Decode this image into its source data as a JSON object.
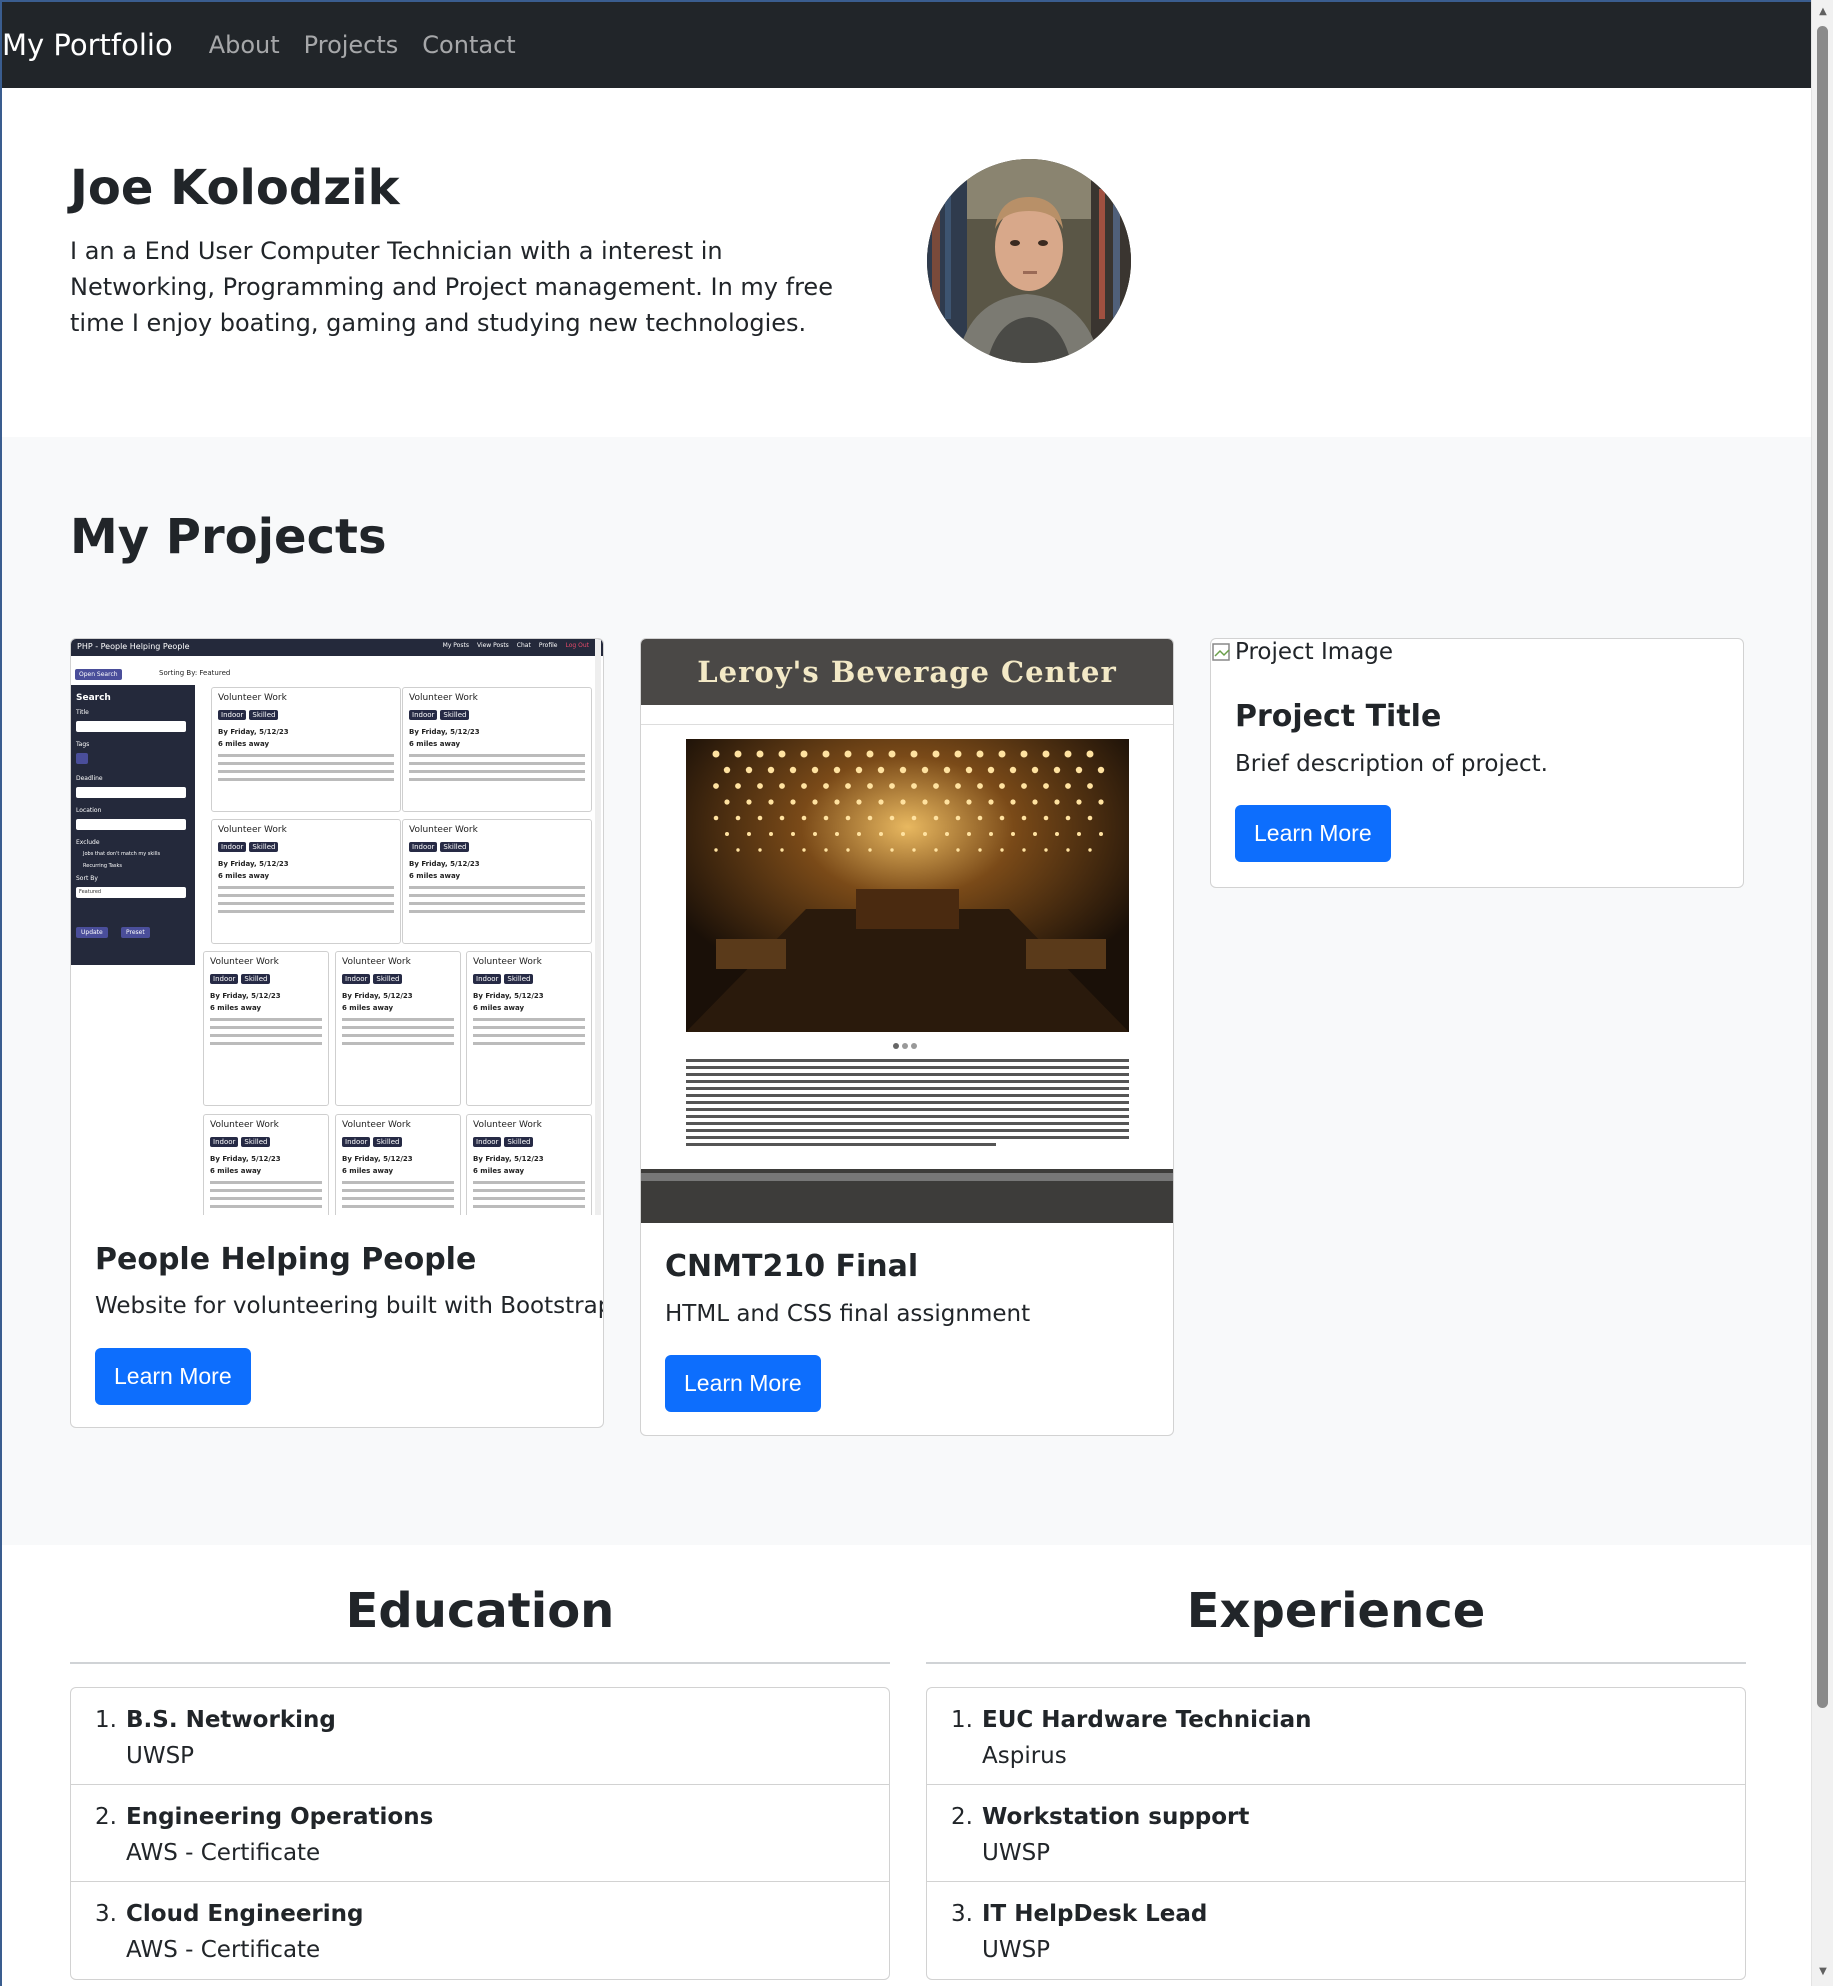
{
  "navbar": {
    "brand": "My Portfolio",
    "links": [
      "About",
      "Projects",
      "Contact"
    ]
  },
  "hero": {
    "name": "Joe Kolodzik",
    "bio": "I an a End User Computer Technician with a interest in Networking, Programming and Project management. In my free time I enjoy boating, gaming and studying new technologies."
  },
  "projects": {
    "title": "My Projects",
    "cards": [
      {
        "title": "People Helping People",
        "description": "Website for volunteering built with Bootstrap.",
        "button": "Learn More",
        "thumbnail": {
          "site_title": "PHP - People Helping People",
          "nav": [
            "My Posts",
            "View Posts",
            "Chat",
            "Profile",
            "Log Out"
          ],
          "open_search": "Open Search",
          "sorting": "Sorting By: Featured",
          "sidebar": {
            "heading": "Search",
            "fields": [
              "Title",
              "Tags",
              "Deadline",
              "Location"
            ],
            "exclude": "Exclude",
            "options": [
              "Jobs that don't match my skills",
              "Recurring Tasks"
            ],
            "sort_by": "Sort By",
            "sort_value": "Featured",
            "update": "Update",
            "preset": "Preset"
          },
          "post": {
            "title": "Volunteer Work",
            "tags": [
              "Indoor",
              "Skilled"
            ],
            "date": "By Friday, 5/12/23",
            "distance": "6 miles away"
          }
        }
      },
      {
        "title": "CNMT210 Final",
        "description": "HTML and CSS final assignment",
        "button": "Learn More",
        "thumbnail": {
          "site_title": "Leroy's Beverage Center"
        }
      },
      {
        "title": "Project Title",
        "description": "Brief description of project.",
        "button": "Learn More",
        "image_alt": "Project Image"
      }
    ]
  },
  "education": {
    "title": "Education",
    "items": [
      {
        "num": "1.",
        "title": "B.S. Networking",
        "sub": "UWSP"
      },
      {
        "num": "2.",
        "title": "Engineering Operations",
        "sub": "AWS - Certificate"
      },
      {
        "num": "3.",
        "title": "Cloud Engineering",
        "sub": "AWS - Certificate"
      }
    ]
  },
  "experience": {
    "title": "Experience",
    "items": [
      {
        "num": "1.",
        "title": "EUC Hardware Technician",
        "sub": "Aspirus"
      },
      {
        "num": "2.",
        "title": "Workstation support",
        "sub": "UWSP"
      },
      {
        "num": "3.",
        "title": "IT HelpDesk Lead",
        "sub": "UWSP"
      }
    ]
  },
  "colors": {
    "navbar_bg": "#212529",
    "primary": "#0d6efd",
    "section_bg": "#f8f9fa"
  }
}
